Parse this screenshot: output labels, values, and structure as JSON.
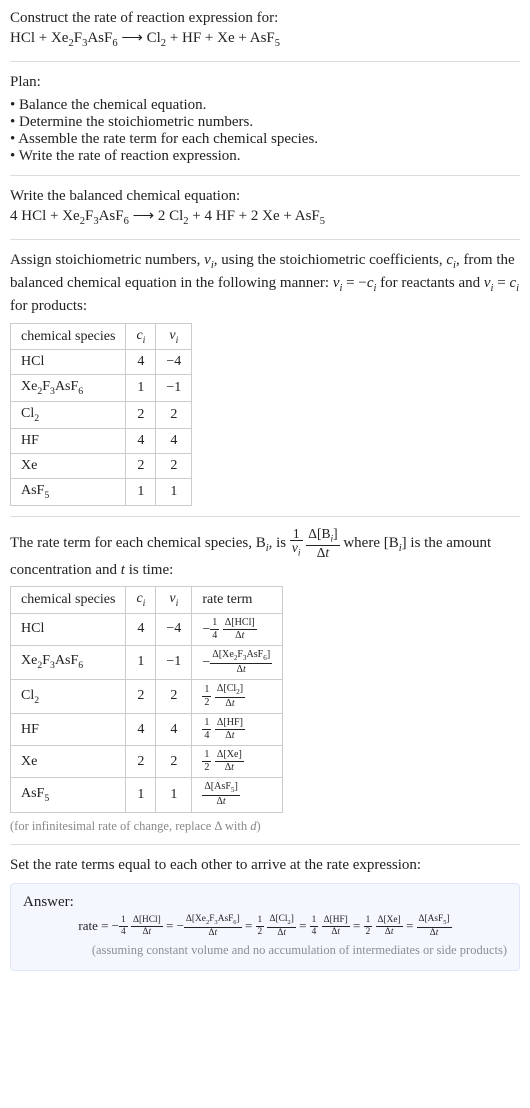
{
  "header": {
    "title": "Construct the rate of reaction expression for:",
    "equation_html": "HCl + Xe<sub>2</sub>F<sub>3</sub>AsF<sub>6</sub> <span class='arrow'>⟶</span> Cl<sub>2</sub> + HF + Xe + AsF<sub>5</sub>"
  },
  "plan": {
    "title": "Plan:",
    "items": [
      "Balance the chemical equation.",
      "Determine the stoichiometric numbers.",
      "Assemble the rate term for each chemical species.",
      "Write the rate of reaction expression."
    ]
  },
  "balanced": {
    "title": "Write the balanced chemical equation:",
    "equation_html": "4 HCl + Xe<sub>2</sub>F<sub>3</sub>AsF<sub>6</sub> <span class='arrow'>⟶</span> 2 Cl<sub>2</sub> + 4 HF + 2 Xe + AsF<sub>5</sub>"
  },
  "stoich": {
    "intro_html": "Assign stoichiometric numbers, <span class='ital'>ν<sub>i</sub></span>, using the stoichiometric coefficients, <span class='ital'>c<sub>i</sub></span>, from the balanced chemical equation in the following manner: <span class='ital'>ν<sub>i</sub></span> = −<span class='ital'>c<sub>i</sub></span> for reactants and <span class='ital'>ν<sub>i</sub></span> = <span class='ital'>c<sub>i</sub></span> for products:",
    "headers": {
      "species": "chemical species",
      "ci_html": "<span class='ital'>c<sub>i</sub></span>",
      "vi_html": "<span class='ital'>ν<sub>i</sub></span>"
    },
    "rows": [
      {
        "species_html": "HCl",
        "ci": "4",
        "vi": "−4"
      },
      {
        "species_html": "Xe<sub>2</sub>F<sub>3</sub>AsF<sub>6</sub>",
        "ci": "1",
        "vi": "−1"
      },
      {
        "species_html": "Cl<sub>2</sub>",
        "ci": "2",
        "vi": "2"
      },
      {
        "species_html": "HF",
        "ci": "4",
        "vi": "4"
      },
      {
        "species_html": "Xe",
        "ci": "2",
        "vi": "2"
      },
      {
        "species_html": "AsF<sub>5</sub>",
        "ci": "1",
        "vi": "1"
      }
    ]
  },
  "rate_intro": {
    "part1_html": "The rate term for each chemical species, B<sub><span class='ital'>i</span></sub>, is ",
    "coeff_frac": {
      "num": "1",
      "den_html": "<span class='ital'>ν<sub>i</sub></span>"
    },
    "dconc_frac": {
      "num_html": "Δ[B<sub><span class='ital'>i</span></sub>]",
      "den_html": "Δ<span class='ital'>t</span>"
    },
    "part2_html": " where [B<sub><span class='ital'>i</span></sub>] is the amount concentration and <span class='ital'>t</span> is time:"
  },
  "rate_table": {
    "headers": {
      "species": "chemical species",
      "ci_html": "<span class='ital'>c<sub>i</sub></span>",
      "vi_html": "<span class='ital'>ν<sub>i</sub></span>",
      "rate": "rate term"
    },
    "rows": [
      {
        "species_html": "HCl",
        "ci": "4",
        "vi": "−4",
        "rate_html": "−<span class='sfrac'><span class='num'>1</span><span class='den'>4</span></span> <span class='sfrac'><span class='num'>Δ[HCl]</span><span class='den'>Δ<span class='ital'>t</span></span></span>"
      },
      {
        "species_html": "Xe<sub>2</sub>F<sub>3</sub>AsF<sub>6</sub>",
        "ci": "1",
        "vi": "−1",
        "rate_html": "−<span class='sfrac'><span class='num'>Δ[Xe<sub>2</sub>F<sub>3</sub>AsF<sub>6</sub>]</span><span class='den'>Δ<span class='ital'>t</span></span></span>"
      },
      {
        "species_html": "Cl<sub>2</sub>",
        "ci": "2",
        "vi": "2",
        "rate_html": "<span class='sfrac'><span class='num'>1</span><span class='den'>2</span></span> <span class='sfrac'><span class='num'>Δ[Cl<sub>2</sub>]</span><span class='den'>Δ<span class='ital'>t</span></span></span>"
      },
      {
        "species_html": "HF",
        "ci": "4",
        "vi": "4",
        "rate_html": "<span class='sfrac'><span class='num'>1</span><span class='den'>4</span></span> <span class='sfrac'><span class='num'>Δ[HF]</span><span class='den'>Δ<span class='ital'>t</span></span></span>"
      },
      {
        "species_html": "Xe",
        "ci": "2",
        "vi": "2",
        "rate_html": "<span class='sfrac'><span class='num'>1</span><span class='den'>2</span></span> <span class='sfrac'><span class='num'>Δ[Xe]</span><span class='den'>Δ<span class='ital'>t</span></span></span>"
      },
      {
        "species_html": "AsF<sub>5</sub>",
        "ci": "1",
        "vi": "1",
        "rate_html": "<span class='sfrac'><span class='num'>Δ[AsF<sub>5</sub>]</span><span class='den'>Δ<span class='ital'>t</span></span></span>"
      }
    ],
    "footnote_html": "(for infinitesimal rate of change, replace Δ with <span class='ital'>d</span>)"
  },
  "set_equal": "Set the rate terms equal to each other to arrive at the rate expression:",
  "answer": {
    "title": "Answer:",
    "rate_html": "rate = −<span class='sfrac'><span class='num'>1</span><span class='den'>4</span></span> <span class='sfrac'><span class='num'>Δ[HCl]</span><span class='den'>Δ<span class='ital'>t</span></span></span> = −<span class='sfrac'><span class='num'>Δ[Xe<sub>2</sub>F<sub>3</sub>AsF<sub>6</sub>]</span><span class='den'>Δ<span class='ital'>t</span></span></span> = <span class='sfrac'><span class='num'>1</span><span class='den'>2</span></span> <span class='sfrac'><span class='num'>Δ[Cl<sub>2</sub>]</span><span class='den'>Δ<span class='ital'>t</span></span></span> = <span class='sfrac'><span class='num'>1</span><span class='den'>4</span></span> <span class='sfrac'><span class='num'>Δ[HF]</span><span class='den'>Δ<span class='ital'>t</span></span></span> = <span class='sfrac'><span class='num'>1</span><span class='den'>2</span></span> <span class='sfrac'><span class='num'>Δ[Xe]</span><span class='den'>Δ<span class='ital'>t</span></span></span> = <span class='sfrac'><span class='num'>Δ[AsF<sub>5</sub>]</span><span class='den'>Δ<span class='ital'>t</span></span></span>",
    "assumption": "(assuming constant volume and no accumulation of intermediates or side products)"
  },
  "chart_data": {
    "type": "table",
    "title": "Stoichiometric numbers and rate terms for HCl + Xe2F3AsF6 → Cl2 + HF + Xe + AsF5",
    "balanced_equation": "4 HCl + Xe2F3AsF6 → 2 Cl2 + 4 HF + 2 Xe + AsF5",
    "species": [
      "HCl",
      "Xe2F3AsF6",
      "Cl2",
      "HF",
      "Xe",
      "AsF5"
    ],
    "c_i": [
      4,
      1,
      2,
      4,
      2,
      1
    ],
    "nu_i": [
      -4,
      -1,
      2,
      4,
      2,
      1
    ],
    "rate_terms": [
      "-(1/4) d[HCl]/dt",
      "- d[Xe2F3AsF6]/dt",
      "(1/2) d[Cl2]/dt",
      "(1/4) d[HF]/dt",
      "(1/2) d[Xe]/dt",
      "d[AsF5]/dt"
    ],
    "rate_expression": "rate = -(1/4) d[HCl]/dt = - d[Xe2F3AsF6]/dt = (1/2) d[Cl2]/dt = (1/4) d[HF]/dt = (1/2) d[Xe]/dt = d[AsF5]/dt"
  }
}
